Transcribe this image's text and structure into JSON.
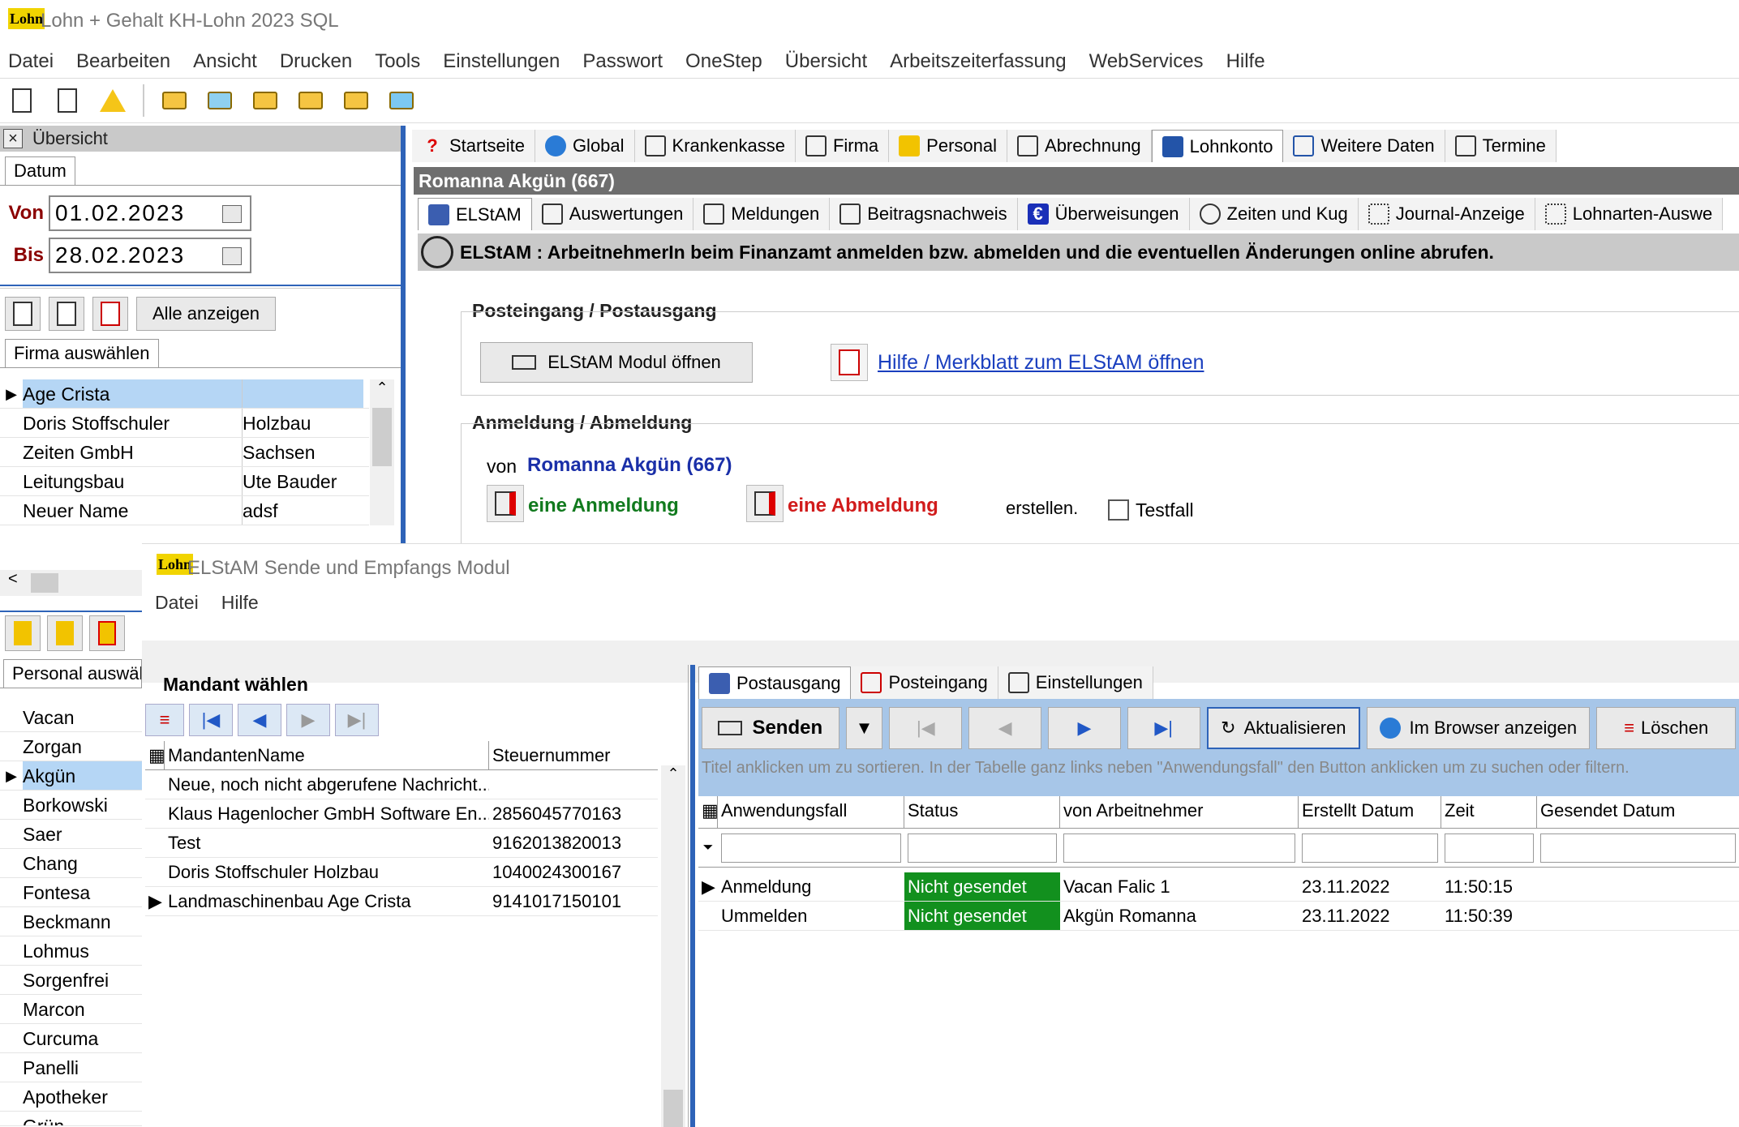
{
  "app": {
    "title": "Lohn + Gehalt KH-Lohn 2023 SQL",
    "logo": "Lohn"
  },
  "menu": [
    "Datei",
    "Bearbeiten",
    "Ansicht",
    "Drucken",
    "Tools",
    "Einstellungen",
    "Passwort",
    "OneStep",
    "Übersicht",
    "Arbeitszeiterfassung",
    "WebServices",
    "Hilfe"
  ],
  "left": {
    "header": "Übersicht",
    "date_tab": "Datum",
    "von_label": "Von",
    "von_value": "01.02.2023",
    "bis_label": "Bis",
    "bis_value": "28.02.2023",
    "all_button": "Alle anzeigen",
    "firma_tab": "Firma auswählen",
    "firms": [
      {
        "name": "Age Crista",
        "info": ""
      },
      {
        "name": "Doris Stoffschuler",
        "info": "Holzbau"
      },
      {
        "name": "Zeiten GmbH",
        "info": "Sachsen"
      },
      {
        "name": "Leitungsbau",
        "info": "Ute Bauder"
      },
      {
        "name": "Neuer Name",
        "info": "adsf"
      }
    ],
    "personal_tab": "Personal auswäh",
    "persons": [
      "Vacan",
      "Zorgan",
      "Akgün",
      "Borkowski",
      "Saer",
      "Chang",
      "Fontesa",
      "Beckmann",
      "Lohmus",
      "Sorgenfrei",
      "Marcon",
      "Curcuma",
      "Panelli",
      "Apotheker",
      "Grün"
    ]
  },
  "main": {
    "tabs": [
      "Startseite",
      "Global",
      "Krankenkasse",
      "Firma",
      "Personal",
      "Abrechnung",
      "Lohnkonto",
      "Weitere Daten",
      "Termine"
    ],
    "employee": "Romanna Akgün (667)",
    "subtabs": [
      "ELStAM",
      "Auswertungen",
      "Meldungen",
      "Beitragsnachweis",
      "Überweisungen",
      "Zeiten und Kug",
      "Journal-Anzeige",
      "Lohnarten-Auswe"
    ],
    "banner": "ELStAM : ArbeitnehmerIn beim Finanzamt anmelden bzw. abmelden und die eventuellen Änderungen online abrufen.",
    "post_title": "Posteingang / Postausgang",
    "open_module": "ELStAM Modul öffnen",
    "help_link": "Hilfe / Merkblatt zum ELStAM öffnen",
    "anmeldung_title": "Anmeldung / Abmeldung",
    "von": "von",
    "von_name": "Romanna Akgün (667)",
    "anmeldung": "eine Anmeldung",
    "abmeldung": "eine Abmeldung",
    "erstellen": "erstellen.",
    "testfall": "Testfall"
  },
  "module": {
    "title": "ELStAM Sende und Empfangs Modul",
    "menu": [
      "Datei",
      "Hilfe"
    ],
    "mandant_title": "Mandant wählen",
    "mandant_cols": [
      "MandantenName",
      "Steuernummer"
    ],
    "mandants": [
      {
        "name": "Neue, noch nicht abgerufene Nachricht...",
        "nr": ""
      },
      {
        "name": "Klaus Hagenlocher GmbH Software En...",
        "nr": "2856045770163"
      },
      {
        "name": "Test",
        "nr": "9162013820013"
      },
      {
        "name": " Doris Stoffschuler Holzbau",
        "nr": "1040024300167"
      },
      {
        "name": "Landmaschinenbau Age Crista",
        "nr": "9141017150101"
      }
    ],
    "tabs": [
      "Postausgang",
      "Posteingang",
      "Einstellungen"
    ],
    "send": "Senden",
    "refresh": "Aktualisieren",
    "browser": "Im Browser anzeigen",
    "delete": "Löschen",
    "hint": "Titel anklicken um zu sortieren. In der Tabelle ganz links neben \"Anwendungsfall\" den Button anklicken um zu suchen oder filtern.",
    "cols": [
      "Anwendungsfall",
      "Status",
      "von Arbeitnehmer",
      "Erstellt Datum",
      "Zeit",
      "Gesendet Datum"
    ],
    "rows": [
      {
        "fall": "Anmeldung",
        "status": "Nicht gesendet",
        "an": "Vacan Falic 1",
        "datum": "23.11.2022",
        "zeit": "11:50:15",
        "gesendet": ""
      },
      {
        "fall": "Ummelden",
        "status": "Nicht gesendet",
        "an": "Akgün Romanna",
        "datum": "23.11.2022",
        "zeit": "11:50:39",
        "gesendet": ""
      }
    ]
  }
}
